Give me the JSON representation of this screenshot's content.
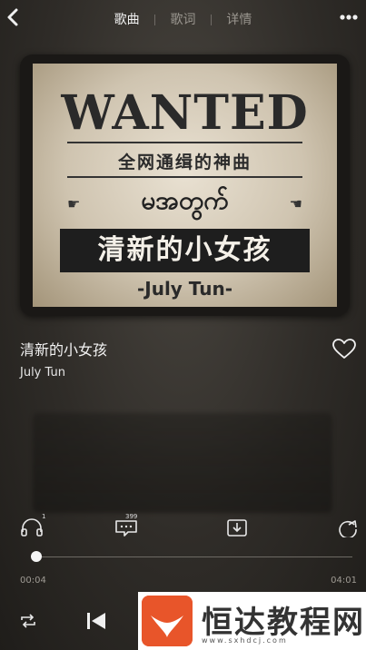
{
  "header": {
    "tabs": [
      {
        "label": "歌曲",
        "active": true
      },
      {
        "label": "歌词",
        "active": false
      },
      {
        "label": "详情",
        "active": false
      }
    ]
  },
  "cover": {
    "wanted": "WANTED",
    "subtitle": "全网通缉的神曲",
    "myanmar": "မအတွက်",
    "title": "清新的小女孩",
    "artist": "-July Tun-"
  },
  "song": {
    "title": "清新的小女孩",
    "artist": "July Tun",
    "liked": false
  },
  "actions": {
    "listen_count": "1",
    "comment_count": "399"
  },
  "player": {
    "current_time": "00:04",
    "duration": "04:01",
    "progress": 0.017
  },
  "watermark": {
    "title": "恒达教程网",
    "url": "www.sxhdcj.com"
  },
  "colors": {
    "accent": "#f5f5f5",
    "watermark_logo": "#e8552a"
  }
}
